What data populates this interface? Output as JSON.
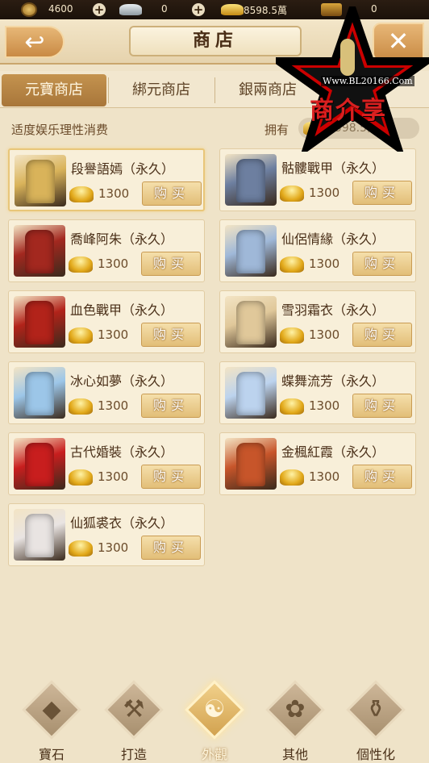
{
  "currency_bar": {
    "coins": "4600",
    "silver": "0",
    "gold_ingots": "8598.5萬",
    "tickets": "0"
  },
  "header": {
    "title": "商店"
  },
  "tabs": [
    {
      "label": "元寶商店",
      "active": true
    },
    {
      "label": "綁元商店",
      "active": false
    },
    {
      "label": "銀兩商店",
      "active": false
    }
  ],
  "info": {
    "notice": "适度娱乐理性消费",
    "owned_label": "拥有",
    "owned_value": "8598.5萬"
  },
  "items": [
    {
      "name": "段譽語嫣（永久）",
      "price": "1300",
      "buy": "购买",
      "color": "#d9b35a"
    },
    {
      "name": "骷髏戰甲（永久）",
      "price": "1300",
      "buy": "购买",
      "color": "#6d7fa0"
    },
    {
      "name": "喬峰阿朱（永久）",
      "price": "1300",
      "buy": "购买",
      "color": "#a3281f"
    },
    {
      "name": "仙侶情緣（永久）",
      "price": "1300",
      "buy": "购买",
      "color": "#9fb8d8"
    },
    {
      "name": "血色戰甲（永久）",
      "price": "1300",
      "buy": "购买",
      "color": "#b2231a"
    },
    {
      "name": "雪羽霜衣（永久）",
      "price": "1300",
      "buy": "购买",
      "color": "#e0c89a"
    },
    {
      "name": "冰心如夢（永久）",
      "price": "1300",
      "buy": "购买",
      "color": "#9cc6e8"
    },
    {
      "name": "蝶舞流芳（永久）",
      "price": "1300",
      "buy": "购买",
      "color": "#bcd3ee"
    },
    {
      "name": "古代婚裝（永久）",
      "price": "1300",
      "buy": "购买",
      "color": "#c81e1e"
    },
    {
      "name": "金楓紅霞（永久）",
      "price": "1300",
      "buy": "购买",
      "color": "#c7552a"
    },
    {
      "name": "仙狐裘衣（永久）",
      "price": "1300",
      "buy": "购买",
      "color": "#e9e4e2"
    }
  ],
  "bottom_nav": [
    {
      "label": "寶石",
      "icon": "gem-icon",
      "glyph": "◆",
      "active": false
    },
    {
      "label": "打造",
      "icon": "anvil-icon",
      "glyph": "⚒",
      "active": false
    },
    {
      "label": "外觀",
      "icon": "mask-icon",
      "glyph": "☯",
      "active": true
    },
    {
      "label": "其他",
      "icon": "flower-icon",
      "glyph": "✿",
      "active": false
    },
    {
      "label": "個性化",
      "icon": "vase-icon",
      "glyph": "⚱",
      "active": false
    }
  ],
  "watermark": {
    "url": "Www.BL20166.Com",
    "chars": "商介享"
  }
}
